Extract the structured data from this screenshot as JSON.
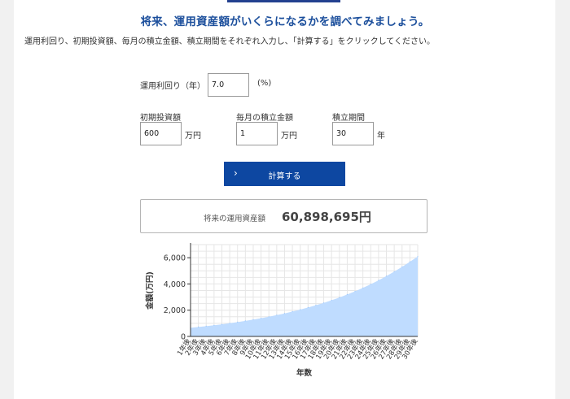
{
  "heading": "将来、運用資産額がいくらになるかを調べてみましょう。",
  "instruction": "運用利回り、初期投資額、毎月の積立金額、積立期間をそれぞれ入力し、「計算する」をクリックしてください。",
  "form": {
    "rate": {
      "label": "運用利回り（年）",
      "value": "7.0",
      "unit": "(%)"
    },
    "initial": {
      "label": "初期投資額",
      "value": "600",
      "unit": "万円"
    },
    "monthly": {
      "label": "毎月の積立金額",
      "value": "1",
      "unit": "万円"
    },
    "period": {
      "label": "積立期間",
      "value": "30",
      "unit": "年"
    }
  },
  "button": {
    "label": "計算する",
    "icon": "chevron-right-icon"
  },
  "result": {
    "label": "将来の運用資産額",
    "value": "60,898,695円"
  },
  "colors": {
    "heading": "#1c4f9c",
    "button": "#0d47a1",
    "area_fill": "#bfdcff"
  },
  "chart_data": {
    "type": "area",
    "xlabel": "年数",
    "ylabel": "金額(万円)",
    "x": [
      "1年後",
      "2年後",
      "3年後",
      "4年後",
      "5年後",
      "6年後",
      "7年後",
      "8年後",
      "9年後",
      "10年後",
      "11年後",
      "12年後",
      "13年後",
      "14年後",
      "15年後",
      "16年後",
      "17年後",
      "18年後",
      "19年後",
      "20年後",
      "21年後",
      "22年後",
      "23年後",
      "24年後",
      "25年後",
      "26年後",
      "27年後",
      "28年後",
      "29年後",
      "30年後"
    ],
    "y_ticks": [
      "0",
      "2,000",
      "4,000",
      "6,000"
    ],
    "ylim": [
      0,
      7000
    ],
    "grid": true,
    "series": [
      {
        "values": [
          656,
          717,
          782,
          851,
          926,
          1006,
          1091,
          1183,
          1282,
          1388,
          1501,
          1623,
          1754,
          1893,
          2043,
          2204,
          2376,
          2561,
          2758,
          2969,
          3196,
          3438,
          3698,
          3977,
          4275,
          4594,
          4936,
          5302,
          5694,
          6090
        ]
      }
    ]
  }
}
